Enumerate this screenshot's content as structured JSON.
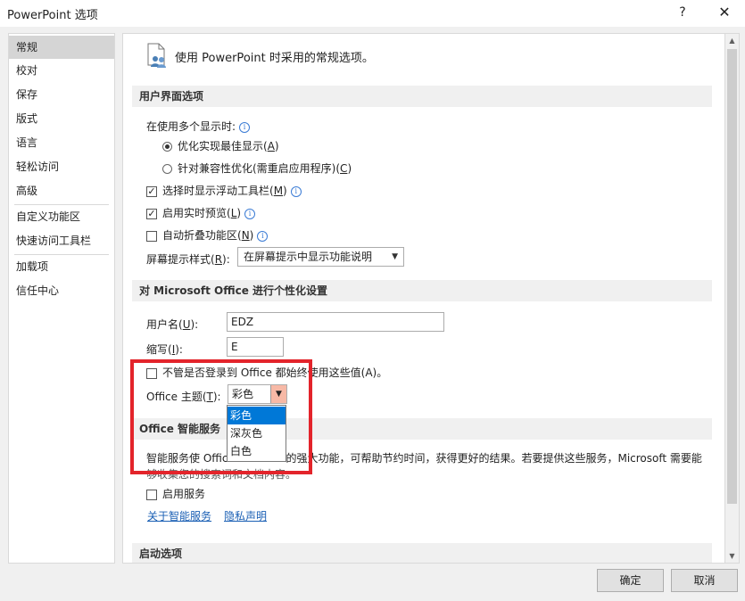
{
  "window": {
    "title": "PowerPoint 选项",
    "help": "?",
    "close": "✕"
  },
  "nav": {
    "items": [
      {
        "label": "常规"
      },
      {
        "label": "校对"
      },
      {
        "label": "保存"
      },
      {
        "label": "版式"
      },
      {
        "label": "语言"
      },
      {
        "label": "轻松访问"
      },
      {
        "label": "高级"
      },
      {
        "label": "自定义功能区"
      },
      {
        "label": "快速访问工具栏"
      },
      {
        "label": "加载项"
      },
      {
        "label": "信任中心"
      }
    ],
    "selected": "常规"
  },
  "header": {
    "text": "使用 PowerPoint 时采用的常规选项。"
  },
  "ui_options": {
    "section_title": "用户界面选项",
    "multi_display_label": "在使用多个显示时:",
    "radio_best": {
      "pre": "优化实现最佳显示(",
      "key": "A",
      "post": ")",
      "checked": true
    },
    "radio_compat": {
      "pre": "针对兼容性优化(需重启应用程序)(",
      "key": "C",
      "post": ")",
      "checked": false
    },
    "mini_toolbar": {
      "pre": "选择时显示浮动工具栏(",
      "key": "M",
      "post": ")",
      "checked": true
    },
    "live_preview": {
      "pre": "启用实时预览(",
      "key": "L",
      "post": ")",
      "checked": true
    },
    "collapse_ribbon": {
      "pre": "自动折叠功能区(",
      "key": "N",
      "post": ")",
      "checked": false
    },
    "screentip_label": {
      "pre": "屏幕提示样式(",
      "key": "R",
      "post": "):"
    },
    "screentip_value": "在屏幕提示中显示功能说明"
  },
  "personalize": {
    "section_title": "对 Microsoft Office 进行个性化设置",
    "username_label": {
      "pre": "用户名(",
      "key": "U",
      "post": "):"
    },
    "username_value": "EDZ",
    "initials_label": {
      "pre": "缩写(",
      "key": "I",
      "post": "):"
    },
    "initials_value": "E",
    "always_use": {
      "text": "不管是否登录到 Office 都始终使用这些值(A)。",
      "checked": false
    },
    "theme_label": {
      "pre": "Office 主题(",
      "key": "T",
      "post": "):"
    },
    "theme_value": "彩色",
    "theme_options": [
      "彩色",
      "深灰色",
      "白色"
    ],
    "theme_highlighted": "彩色"
  },
  "intelligent": {
    "section_title": "Office 智能服务",
    "desc_left": "智能服务使 Offic",
    "desc_right": "的强大功能，可帮助节约时间，获得更好的结果。若要提供这些服务，Microsoft 需要能",
    "desc_line2": "够收集您的搜索词和文档内容。",
    "enable": {
      "text": "启用服务",
      "checked": false
    },
    "link_about": "关于智能服务",
    "link_privacy": "隐私声明"
  },
  "startup": {
    "section_title": "启动选项"
  },
  "footer": {
    "ok": "确定",
    "cancel": "取消"
  },
  "colors": {
    "accent": "#0078d7",
    "highlight_box": "#e3242b",
    "selected_nav": "#d5d5d5"
  }
}
